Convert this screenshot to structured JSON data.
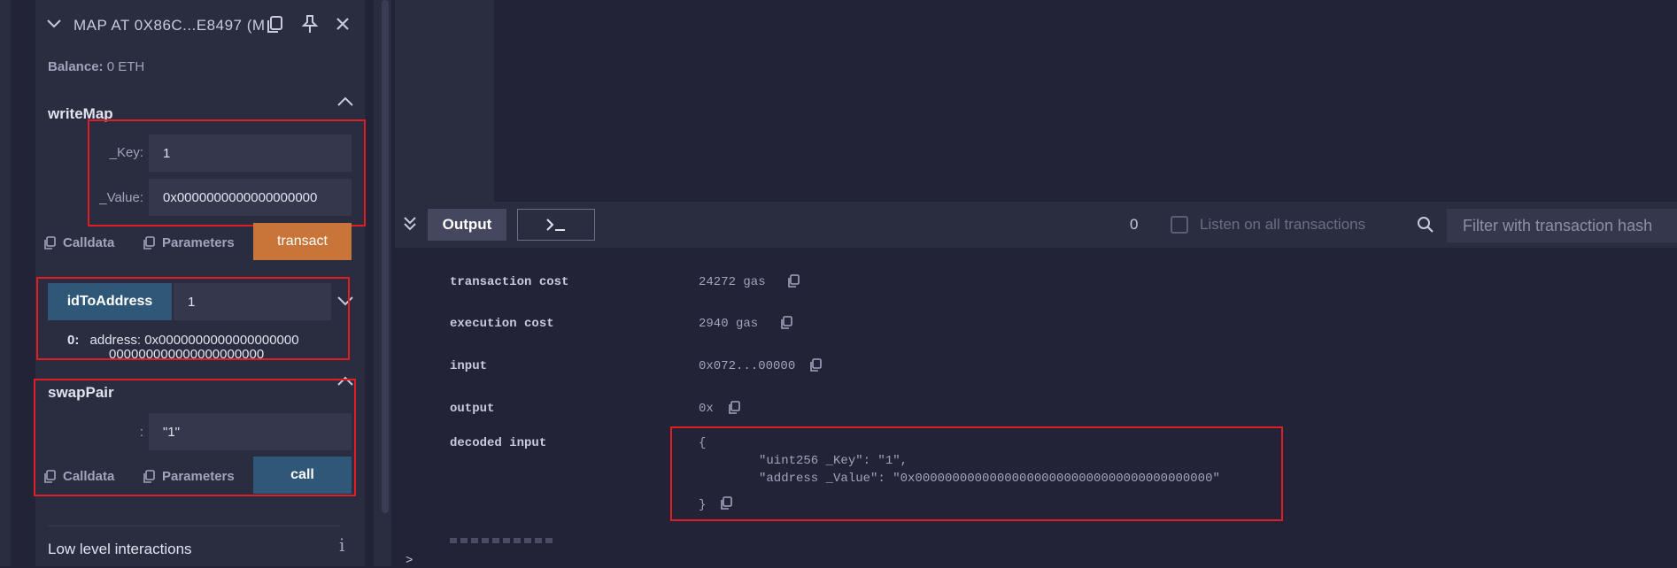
{
  "contract": {
    "title": "MAP AT 0X86C...E8497 (M",
    "balance_label": "Balance:",
    "balance_value": "0 ETH"
  },
  "writeMap": {
    "name": "writeMap",
    "key_label": "_Key:",
    "key_value": "1",
    "value_label": "_Value:",
    "value_value": "0x0000000000000000000",
    "calldata_label": "Calldata",
    "parameters_label": "Parameters",
    "transact_label": "transact"
  },
  "idToAddress": {
    "button_label": "idToAddress",
    "input_value": "1",
    "result_index": "0:",
    "result_line1": "address: 0x0000000000000000000",
    "result_line2": "000000000000000000000"
  },
  "swapPair": {
    "name": "swapPair",
    "param_label": ":",
    "param_value": "\"1\"",
    "calldata_label": "Calldata",
    "parameters_label": "Parameters",
    "call_label": "call"
  },
  "low_level": {
    "label": "Low level interactions",
    "info_icon": "i"
  },
  "terminal": {
    "output_tab": "Output",
    "console_icon": "terminal-icon",
    "count": "0",
    "listen_label": "Listen on all transactions",
    "filter_placeholder": "Filter with transaction hash",
    "rows": [
      {
        "label": "transaction cost",
        "value": "24272 gas"
      },
      {
        "label": "execution cost",
        "value": "2940 gas"
      },
      {
        "label": "input",
        "value": "0x072...00000"
      },
      {
        "label": "output",
        "value": "0x"
      }
    ],
    "decoded_label": "decoded input",
    "decoded_open": "{",
    "decoded_line1": "\"uint256 _Key\": \"1\",",
    "decoded_line2": "\"address _Value\": \"0x0000000000000000000000000000000000000000\"",
    "decoded_close": "}",
    "prompt": ">"
  },
  "colors": {
    "accent_orange": "#c97539",
    "accent_blue": "#2f5778",
    "highlight_red": "#e01c24"
  }
}
